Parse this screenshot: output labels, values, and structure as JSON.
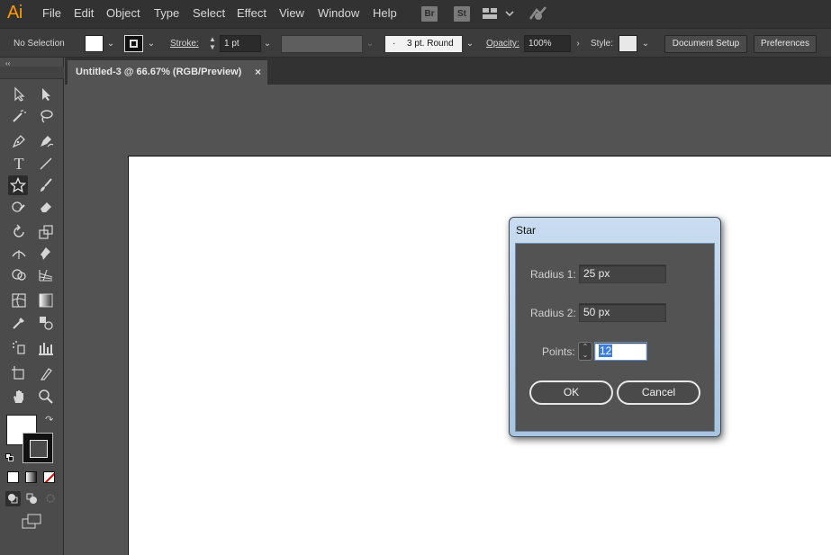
{
  "app": {
    "logo": "Ai"
  },
  "menu": [
    "File",
    "Edit",
    "Object",
    "Type",
    "Select",
    "Effect",
    "View",
    "Window",
    "Help"
  ],
  "app_icons": [
    "Br",
    "St"
  ],
  "control_bar": {
    "selection": "No Selection",
    "stroke_label": "Stroke:",
    "stroke_value": "1 pt",
    "brush": "3 pt. Round",
    "opacity_label": "Opacity:",
    "opacity_value": "100%",
    "style_label": "Style:",
    "document_setup": "Document Setup",
    "preferences": "Preferences"
  },
  "document_tab": {
    "title": "Untitled-3 @ 66.67% (RGB/Preview)",
    "close": "×"
  },
  "dialog": {
    "title": "Star",
    "radius1_label": "Radius 1:",
    "radius1_value": "25 px",
    "radius2_label": "Radius 2:",
    "radius2_value": "50 px",
    "points_label": "Points:",
    "points_value": "12",
    "ok": "OK",
    "cancel": "Cancel"
  },
  "colors": {
    "accent": "#ff9a00",
    "selection": "#3b7ee0",
    "background": "#535353"
  }
}
